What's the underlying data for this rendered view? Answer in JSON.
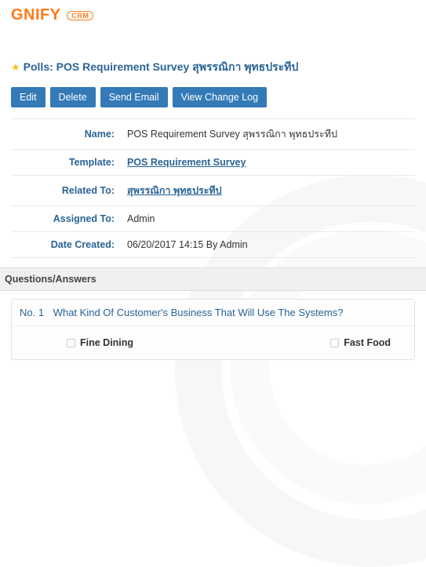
{
  "logo": {
    "text": "GNIFY",
    "badge": "CRM"
  },
  "page": {
    "title_prefix": "Polls:",
    "title": "POS Requirement Survey สุพรรณิกา พุทธประทีป"
  },
  "toolbar": {
    "edit": "Edit",
    "delete": "Delete",
    "send_email": "Send Email",
    "view_log": "View Change Log"
  },
  "details": {
    "labels": {
      "name": "Name:",
      "template": "Template:",
      "related_to": "Related To:",
      "assigned_to": "Assigned To:",
      "date_created": "Date Created:"
    },
    "values": {
      "name": "POS Requirement Survey สุพรรณิกา พุทธประทีป",
      "template": "POS Requirement Survey",
      "related_to": "สุพรรณิกา พุทธประทีป",
      "assigned_to": "Admin",
      "date_created": "06/20/2017 14:15 By Admin"
    }
  },
  "section": {
    "qa_header": "Questions/Answers"
  },
  "question": {
    "number": "No. 1",
    "text": "What Kind Of Customer's Business That Will Use The Systems?",
    "options": [
      "Fine Dining",
      "Fast Food"
    ]
  }
}
